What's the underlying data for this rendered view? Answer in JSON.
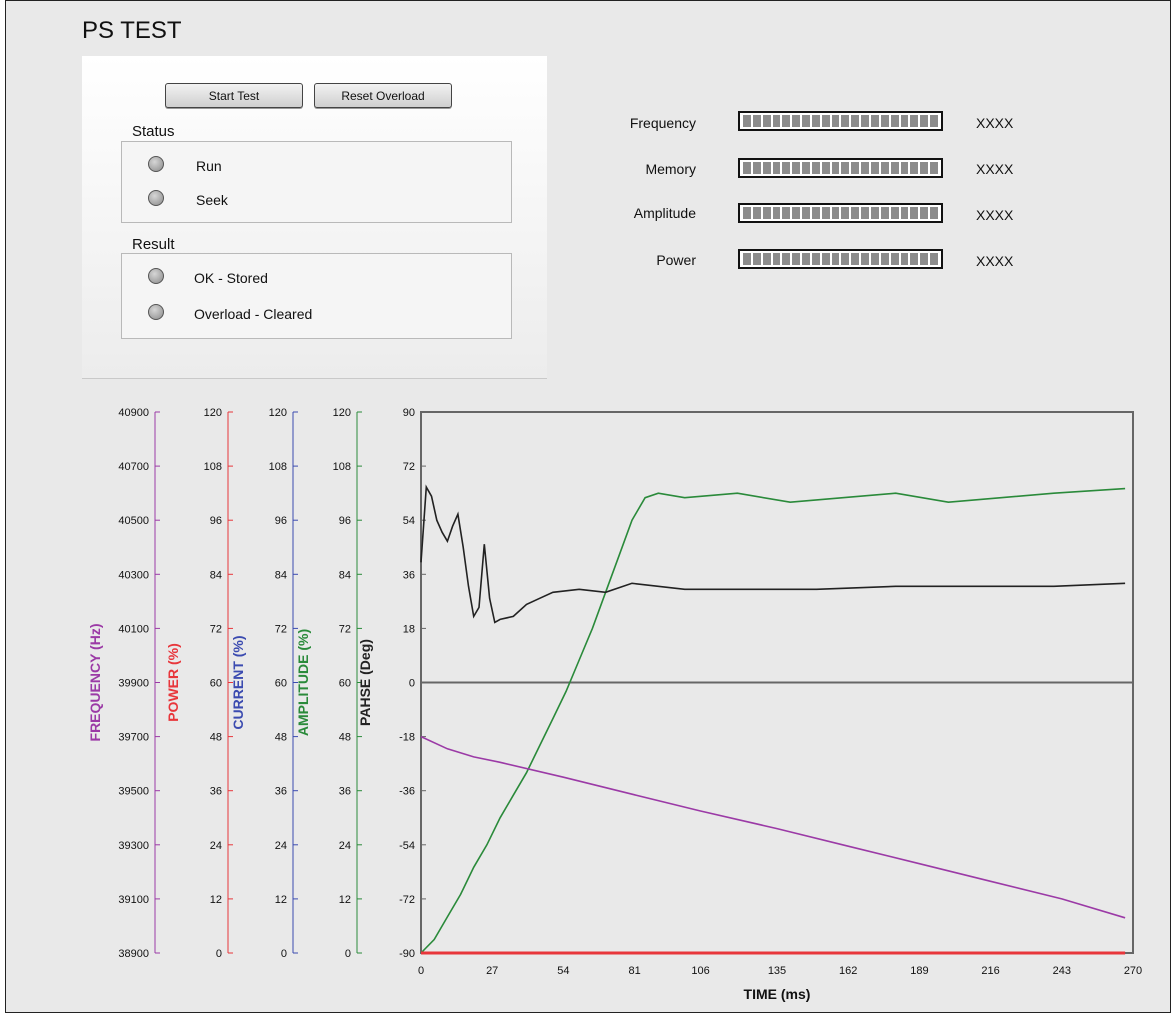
{
  "app": {
    "title": "PS TEST"
  },
  "buttons": {
    "start_test": "Start Test",
    "reset_overload": "Reset Overload"
  },
  "status": {
    "label": "Status",
    "indicators": [
      {
        "label": "Run",
        "state": "off"
      },
      {
        "label": "Seek",
        "state": "off"
      }
    ]
  },
  "result": {
    "label": "Result",
    "indicators": [
      {
        "label": "OK - Stored",
        "state": "off"
      },
      {
        "label": "Overload - Cleared",
        "state": "off"
      }
    ]
  },
  "meters": [
    {
      "label": "Frequency",
      "value": "XXXX"
    },
    {
      "label": "Memory",
      "value": "XXXX"
    },
    {
      "label": "Amplitude",
      "value": "XXXX"
    },
    {
      "label": "Power",
      "value": "XXXX"
    }
  ],
  "colors": {
    "frequency": "#9b3aa6",
    "power": "#e8363b",
    "current": "#3b4bb0",
    "amplitude": "#2a8a3a",
    "phase": "#222222"
  },
  "chart_data": {
    "type": "line",
    "xlabel": "TIME (ms)",
    "xlim": [
      0,
      270
    ],
    "x_ticks": [
      "0",
      "27",
      "54",
      "81",
      "106",
      "135",
      "162",
      "189",
      "216",
      "243",
      "270"
    ],
    "axes": [
      {
        "label": "FREQUENCY (Hz)",
        "color": "#9b3aa6",
        "range": [
          38900,
          40900
        ],
        "ticks": [
          "38900",
          "39100",
          "39300",
          "39500",
          "39700",
          "39900",
          "40100",
          "40300",
          "40500",
          "40700",
          "40900"
        ]
      },
      {
        "label": "POWER (%)",
        "color": "#e8363b",
        "range": [
          0,
          120
        ],
        "ticks": [
          "0",
          "12",
          "24",
          "36",
          "48",
          "60",
          "72",
          "84",
          "96",
          "108",
          "120"
        ]
      },
      {
        "label": "CURRENT (%)",
        "color": "#3b4bb0",
        "range": [
          0,
          120
        ],
        "ticks": [
          "0",
          "12",
          "24",
          "36",
          "48",
          "60",
          "72",
          "84",
          "96",
          "108",
          "120"
        ]
      },
      {
        "label": "AMPLITUDE (%)",
        "color": "#2a8a3a",
        "range": [
          0,
          120
        ],
        "ticks": [
          "0",
          "12",
          "24",
          "36",
          "48",
          "60",
          "72",
          "84",
          "96",
          "108",
          "120"
        ]
      },
      {
        "label": "PAHSE (Deg)",
        "color": "#222222",
        "range": [
          -90,
          90
        ],
        "ticks": [
          "-90",
          "-72",
          "-54",
          "-36",
          "-18",
          "0",
          "18",
          "36",
          "54",
          "72",
          "90"
        ]
      }
    ],
    "series": [
      {
        "axis": "amplitude",
        "color": "#2a8a3a",
        "x": [
          0,
          5,
          10,
          15,
          20,
          25,
          30,
          35,
          40,
          45,
          50,
          55,
          60,
          65,
          70,
          75,
          80,
          85,
          90,
          100,
          120,
          140,
          160,
          180,
          200,
          220,
          240,
          267
        ],
        "y": [
          0,
          3,
          8,
          13,
          19,
          24,
          30,
          35,
          40,
          46,
          52,
          58,
          65,
          72,
          80,
          88,
          96,
          101,
          102,
          101,
          102,
          100,
          101,
          102,
          100,
          101,
          102,
          103
        ]
      },
      {
        "axis": "phase",
        "color": "#222222",
        "x": [
          0,
          2,
          4,
          6,
          8,
          10,
          12,
          14,
          16,
          18,
          20,
          22,
          24,
          26,
          28,
          30,
          35,
          40,
          45,
          50,
          60,
          70,
          80,
          100,
          120,
          150,
          180,
          210,
          240,
          267
        ],
        "y": [
          40,
          65,
          62,
          54,
          50,
          47,
          52,
          56,
          45,
          32,
          22,
          25,
          46,
          28,
          20,
          21,
          22,
          26,
          28,
          30,
          31,
          30,
          33,
          31,
          31,
          31,
          32,
          32,
          32,
          33
        ]
      },
      {
        "axis": "frequency",
        "color": "#9b3aa6",
        "x": [
          0,
          10,
          20,
          30,
          54,
          81,
          106,
          135,
          162,
          189,
          216,
          243,
          267
        ],
        "y": [
          39700,
          39655,
          39625,
          39605,
          39550,
          39485,
          39425,
          39360,
          39295,
          39230,
          39165,
          39100,
          39030
        ]
      },
      {
        "axis": "power",
        "color": "#e8363b",
        "x": [
          0,
          267
        ],
        "y": [
          0,
          0
        ]
      }
    ]
  }
}
